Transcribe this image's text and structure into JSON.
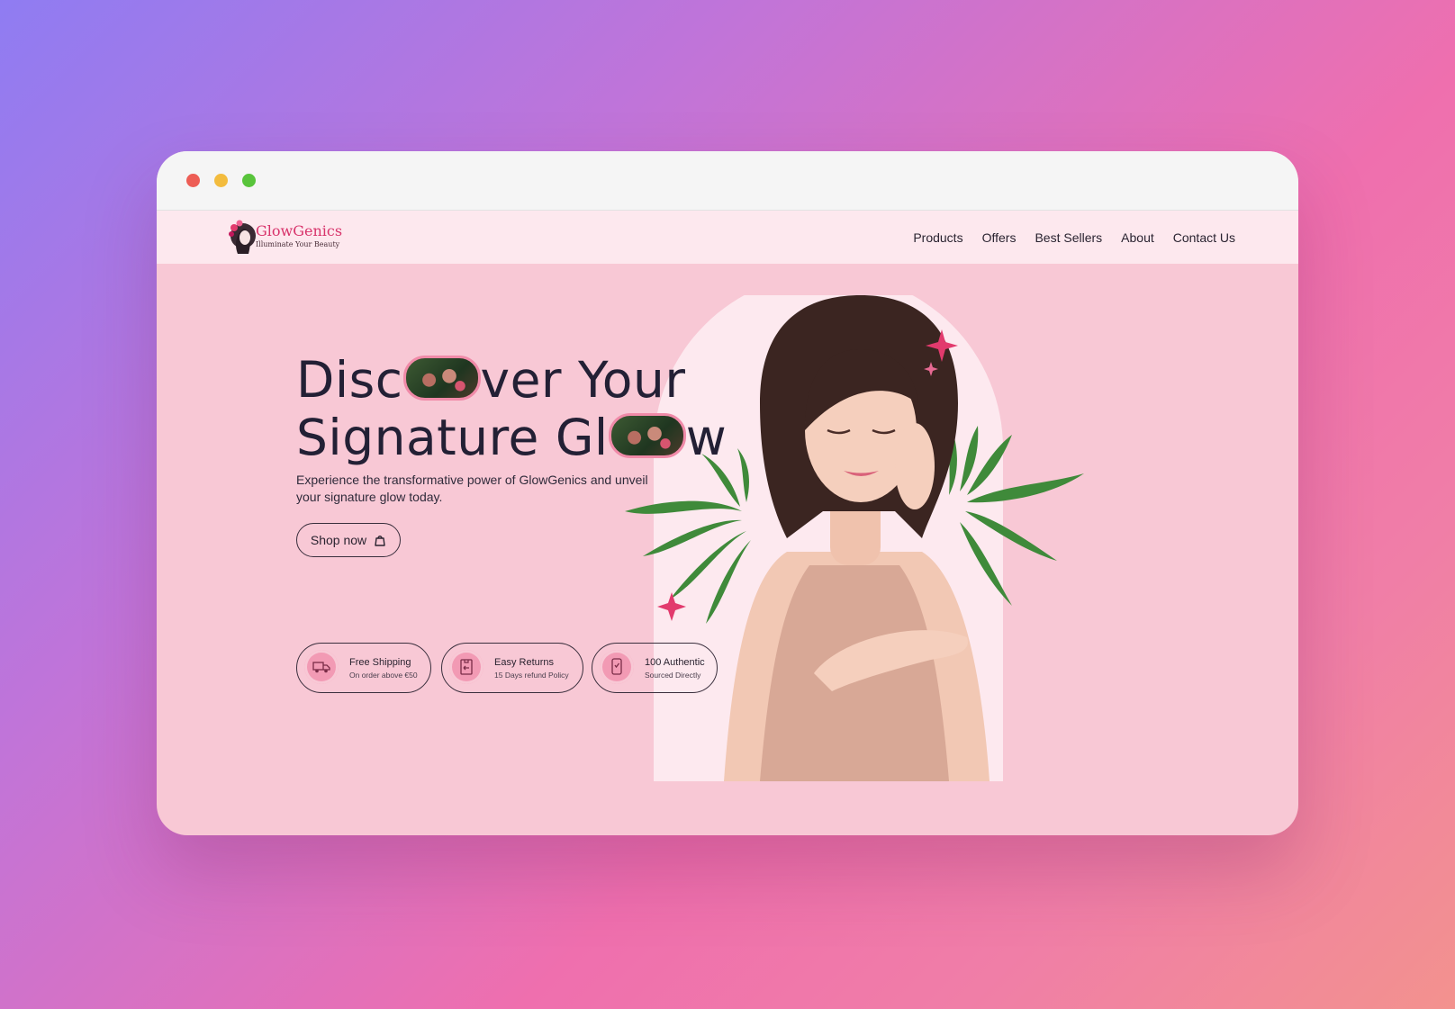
{
  "brand": {
    "name": "GlowGenics",
    "tagline": "Illuminate Your Beauty"
  },
  "nav": {
    "links": [
      "Products",
      "Offers",
      "Best Sellers",
      "About",
      "Contact Us"
    ]
  },
  "hero": {
    "title_line1_a": "Disc",
    "title_line1_b": "ver Your",
    "title_line2_a": "Signature Gl",
    "title_line2_b": "w",
    "subtitle": "Experience the transformative power of GlowGenics and unveil your signature glow today.",
    "cta_label": "Shop now"
  },
  "features": [
    {
      "icon": "truck-icon",
      "title": "Free Shipping",
      "subtitle": "On order above €50"
    },
    {
      "icon": "return-box-icon",
      "title": "Easy Returns",
      "subtitle": "15 Days refund Policy"
    },
    {
      "icon": "authentic-phone-icon",
      "title": "100 Authentic",
      "subtitle": "Sourced Directly"
    }
  ],
  "colors": {
    "accent": "#d8336b",
    "hero_background": "#f8c8d5",
    "navbar_background": "#fde8ee",
    "text": "#232035"
  }
}
